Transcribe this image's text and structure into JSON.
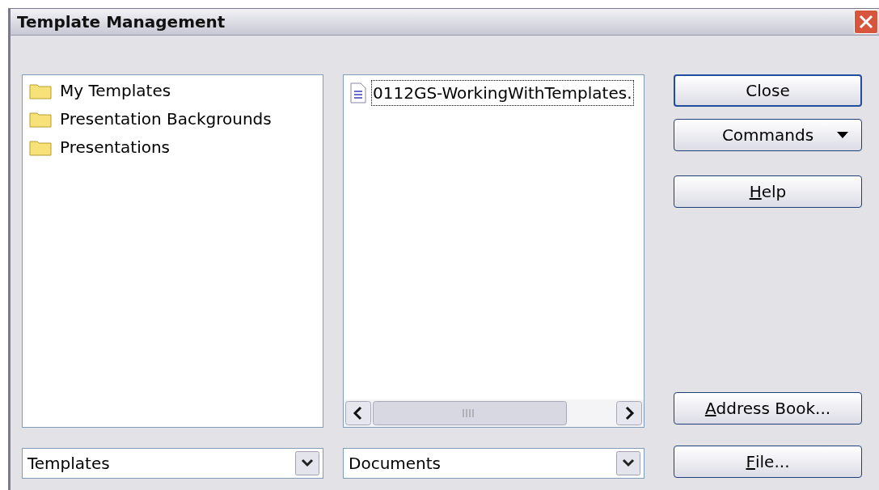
{
  "window": {
    "title": "Template Management"
  },
  "categories": [
    {
      "label": "My Templates",
      "selected": false
    },
    {
      "label": "Presentation Backgrounds",
      "selected": false
    },
    {
      "label": "Presentations",
      "selected": false
    }
  ],
  "files": [
    {
      "label": "0112GS-WorkingWithTemplates.",
      "selected": true
    }
  ],
  "left_combo": {
    "value": "Templates"
  },
  "right_combo": {
    "value": "Documents"
  },
  "buttons": [
    {
      "label": "Close",
      "kind": "default",
      "mnemonic_underlined": false
    },
    {
      "label": "Commands",
      "kind": "menu",
      "mnemonic_underlined": false
    },
    {
      "label": "Help",
      "kind": "plain",
      "mnemonic_underlined": true
    },
    {
      "label": "Address Book...",
      "kind": "plain",
      "mnemonic_underlined": true
    },
    {
      "label": "File...",
      "kind": "plain",
      "mnemonic_underlined": true
    }
  ]
}
